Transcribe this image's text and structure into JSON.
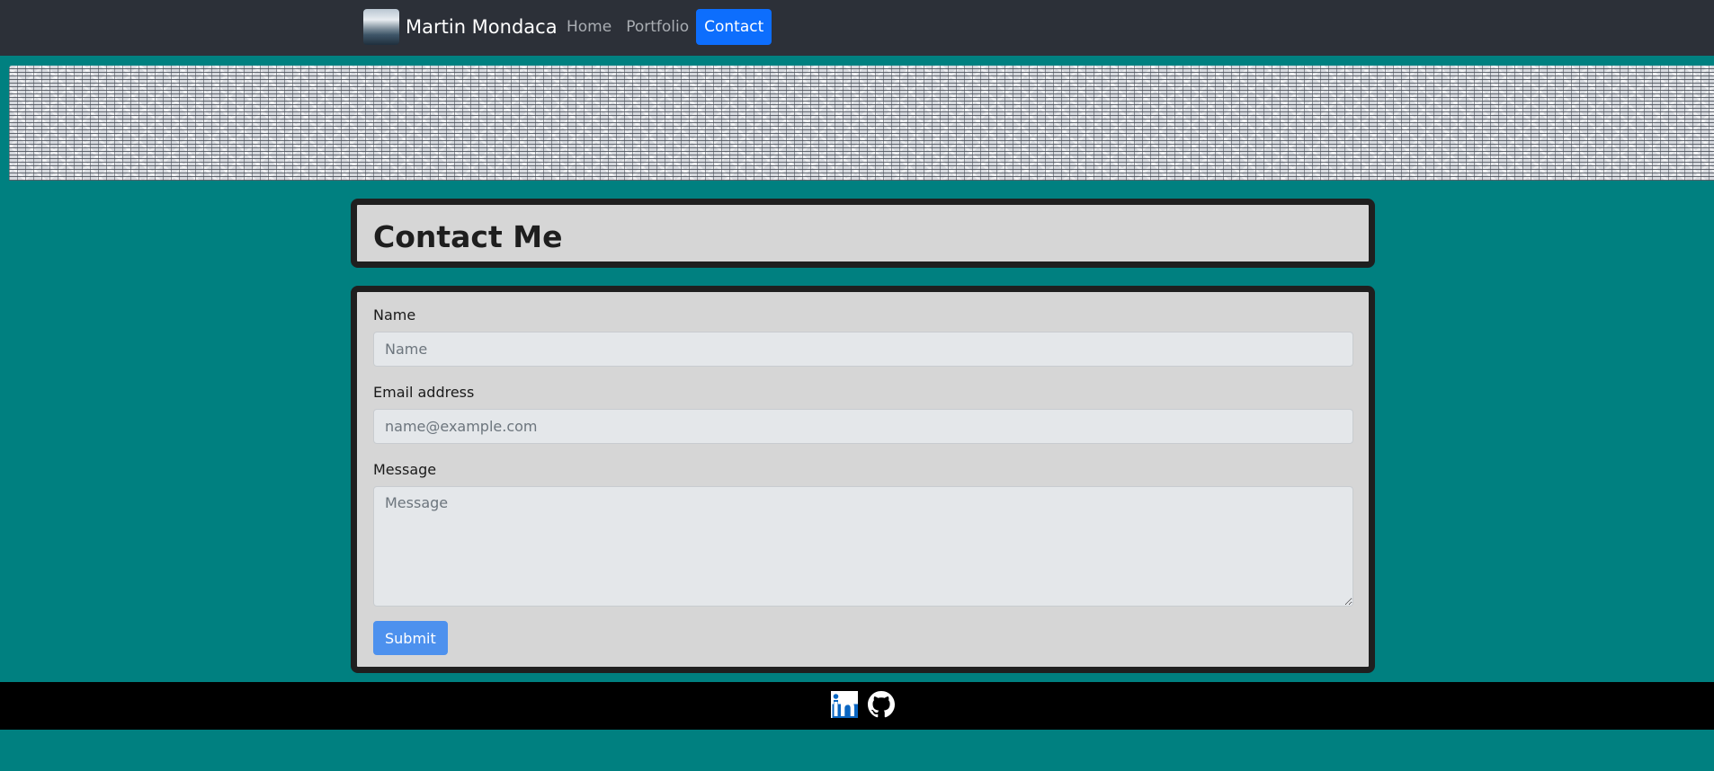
{
  "navbar": {
    "brand_name": "Martin Mondaca",
    "links": [
      {
        "label": "Home",
        "active": false
      },
      {
        "label": "Portfolio",
        "active": false
      },
      {
        "label": "Contact",
        "active": true
      }
    ],
    "active_color": "#0d6efd"
  },
  "page": {
    "title": "Contact Me",
    "background_color": "#008080"
  },
  "form": {
    "name_label": "Name",
    "name_placeholder": "Name",
    "name_value": "",
    "email_label": "Email address",
    "email_placeholder": "name@example.com",
    "email_value": "",
    "message_label": "Message",
    "message_placeholder": "Message",
    "message_value": "",
    "submit_label": "Submit"
  },
  "footer": {
    "icons": [
      "linkedin-icon",
      "github-icon"
    ]
  }
}
